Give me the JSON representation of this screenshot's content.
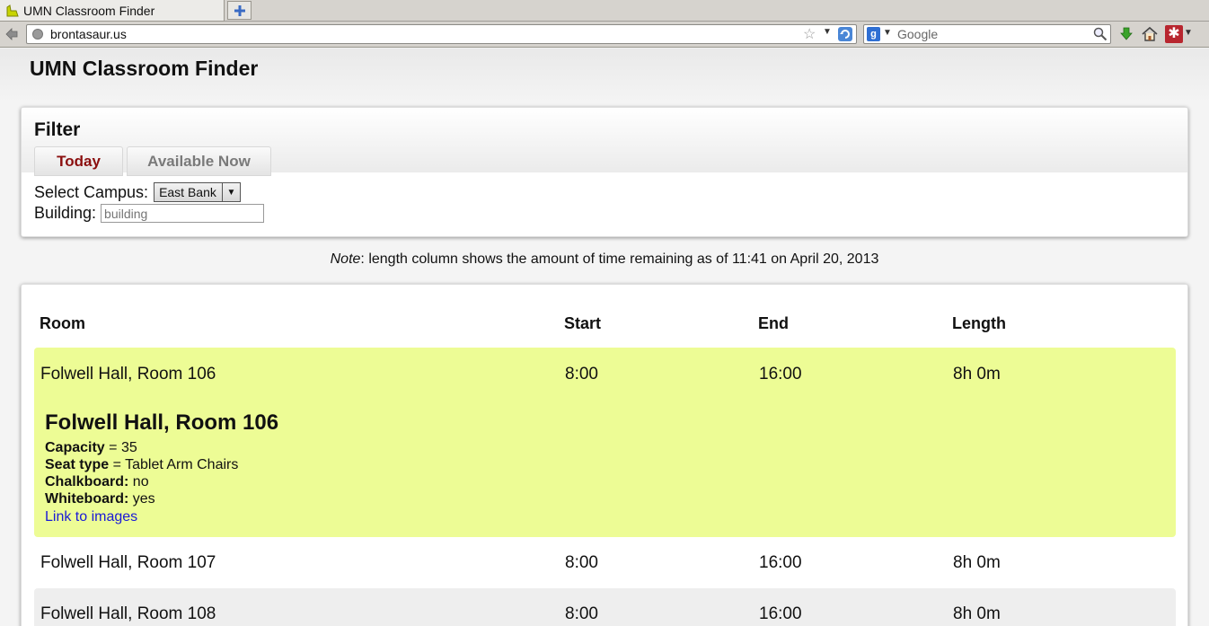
{
  "browser": {
    "tab_title": "UMN Classroom Finder",
    "url": "brontasaur.us",
    "search_placeholder": "Google"
  },
  "page": {
    "site_title": "UMN Classroom Finder",
    "filter": {
      "heading": "Filter",
      "today_label": "Today",
      "available_now_label": "Available Now",
      "campus_label": "Select Campus:",
      "campus_value": "East Bank",
      "building_label": "Building:",
      "building_placeholder": "building"
    },
    "note": {
      "prefix": "Note",
      "text": ": length column shows the amount of time remaining as of 11:41 on April 20, 2013"
    },
    "table": {
      "headers": [
        "Room",
        "Start",
        "End",
        "Length"
      ],
      "rows": [
        {
          "room": "Folwell Hall, Room 106",
          "start": "8:00",
          "end": "16:00",
          "length": "8h 0m",
          "details": {
            "title": "Folwell Hall, Room 106",
            "capacity_label": "Capacity",
            "capacity_value": " = 35",
            "seat_type_label": "Seat type",
            "seat_type_value": " = Tablet Arm Chairs",
            "chalkboard_label": "Chalkboard:",
            "chalkboard_value": " no",
            "whiteboard_label": "Whiteboard:",
            "whiteboard_value": " yes",
            "link_label": "Link to images"
          }
        },
        {
          "room": "Folwell Hall, Room 107",
          "start": "8:00",
          "end": "16:00",
          "length": "8h 0m"
        },
        {
          "room": "Folwell Hall, Room 108",
          "start": "8:00",
          "end": "16:00",
          "length": "8h 0m"
        }
      ]
    }
  },
  "colors": {
    "today_text": "#8b0f0f",
    "selected_row": "#edfc95",
    "alt_row": "#eeeeee",
    "link": "#1a1ad6"
  }
}
